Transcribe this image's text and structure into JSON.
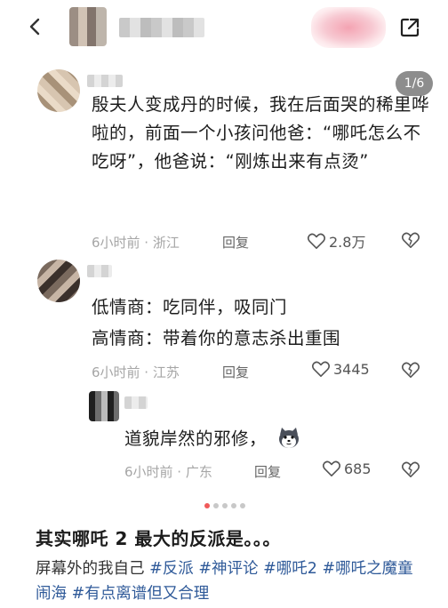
{
  "colors": {
    "tag": "#2f5a99",
    "dot_active": "#f05a5a",
    "meta": "#a6a6a6",
    "indicator_bg": "#8d8d8d"
  },
  "icons": {
    "back": "chevron-left-icon",
    "share": "share-external-icon",
    "like": "heart-outline-icon",
    "dislike": "broken-heart-icon"
  },
  "page_indicator": "1/6",
  "carousel": {
    "total": 5,
    "active": 1
  },
  "comments": [
    {
      "text": "殷夫人变成丹的时候，我在后面哭的稀里哗啦的，前面一个小孩问他爸：“哪吒怎么不吃呀”，他爸说：“刚炼出来有点烫”",
      "time_location": "6小时前 · 浙江",
      "reply": "回复",
      "likes": "2.8万"
    },
    {
      "text_line1": "低情商：吃同伴，吸同门",
      "text_line2": "高情商：带着你的意志杀出重围",
      "time_location": "6小时前 · 江苏",
      "reply": "回复",
      "likes": "3445"
    },
    {
      "text": "道貌岸然的邪修，",
      "time_location": "6小时前 · 广东",
      "reply": "回复",
      "likes": "685"
    }
  ],
  "post": {
    "headline": "其实哪吒 2 最大的反派是。。。",
    "caption_prefix": "屏幕外的我自己 ",
    "tags": [
      "#反派",
      "#神评论",
      "#哪吒2",
      "#哪吒之魔童闹海",
      "#有点离谱但又合理"
    ]
  }
}
